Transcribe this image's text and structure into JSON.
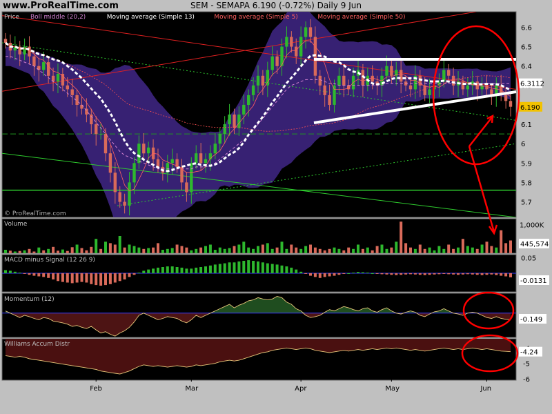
{
  "header": {
    "site": "www.ProRealTime.com",
    "title": "SEM - SEMAPA    6.190 (-0.72%)    Daily  9 Jun"
  },
  "watermark": "© ProRealTime.com",
  "colors": {
    "band": "#3d2580",
    "bull": "#2eb82e",
    "bear": "#d96a5a",
    "price_badge": "#f2c200",
    "bb_badge": "#ffffff",
    "volume_badge": "#ffffff",
    "annotation": "#ff0000"
  },
  "chart_data": [
    {
      "panel": "price",
      "type": "candlestick",
      "legend": [
        "Price",
        "Boll middle (20,2)",
        "Moving average (Simple 13)",
        "Moving average (Simple 5)",
        "Moving average (Simple 50)"
      ],
      "legend_colors": [
        "#c0c0c0",
        "#d080d0",
        "#ffffff",
        "#ff6060",
        "#ff6060"
      ],
      "months": [
        "Feb",
        "Mar",
        "Apr",
        "May",
        "Jun"
      ],
      "month_index": [
        19,
        39,
        62,
        81,
        101
      ],
      "ylim": [
        5.62,
        6.68
      ],
      "yticks": [
        "6.6",
        "6.5",
        "6.4",
        "6.3",
        "6.2",
        "6.1",
        "6",
        "5.9",
        "5.8",
        "5.7"
      ],
      "last_price": "6.190",
      "bb_value": "6.3112",
      "close": [
        6.52,
        6.48,
        6.5,
        6.46,
        6.5,
        6.45,
        6.4,
        6.38,
        6.42,
        6.35,
        6.32,
        6.36,
        6.3,
        6.28,
        6.25,
        6.2,
        6.18,
        6.15,
        6.1,
        6.05,
        6.05,
        5.95,
        5.85,
        5.75,
        5.7,
        5.68,
        5.8,
        5.9,
        6.0,
        5.95,
        5.98,
        5.92,
        5.88,
        5.85,
        5.9,
        5.92,
        5.88,
        5.8,
        5.75,
        5.9,
        5.95,
        5.9,
        5.92,
        5.95,
        6.0,
        6.05,
        6.1,
        6.15,
        6.08,
        6.15,
        6.2,
        6.25,
        6.3,
        6.35,
        6.3,
        6.38,
        6.45,
        6.4,
        6.5,
        6.55,
        6.5,
        6.45,
        6.55,
        6.6,
        6.55,
        6.35,
        6.3,
        6.25,
        6.2,
        6.3,
        6.35,
        6.3,
        6.28,
        6.35,
        6.38,
        6.3,
        6.35,
        6.32,
        6.3,
        6.35,
        6.4,
        6.35,
        6.38,
        6.32,
        6.3,
        6.28,
        6.35,
        6.3,
        6.25,
        6.28,
        6.3,
        6.32,
        6.38,
        6.35,
        6.3,
        6.32,
        6.28,
        6.3,
        6.32,
        6.28,
        6.3,
        6.28,
        6.25,
        6.3,
        6.25,
        6.22,
        6.19
      ],
      "bb_middle": [
        6.45,
        6.45,
        6.44,
        6.43,
        6.42,
        6.41,
        6.4,
        6.38,
        6.36,
        6.34,
        6.32,
        6.3,
        6.28,
        6.26,
        6.24,
        6.22,
        6.2,
        6.17,
        6.14,
        6.11,
        6.08,
        6.05,
        6.02,
        5.99,
        5.96,
        5.94,
        5.93,
        5.92,
        5.91,
        5.9,
        5.89,
        5.88,
        5.87,
        5.87,
        5.87,
        5.87,
        5.87,
        5.87,
        5.87,
        5.87,
        5.88,
        5.88,
        5.88,
        5.89,
        5.9,
        5.92,
        5.94,
        5.96,
        5.98,
        6.0,
        6.02,
        6.04,
        6.07,
        6.1,
        6.13,
        6.16,
        6.19,
        6.22,
        6.25,
        6.28,
        6.3,
        6.31,
        6.32,
        6.33,
        6.33,
        6.33,
        6.33,
        6.32,
        6.31,
        6.31,
        6.3,
        6.3,
        6.3,
        6.3,
        6.3,
        6.3,
        6.3,
        6.3,
        6.3,
        6.3,
        6.31,
        6.31,
        6.31,
        6.31,
        6.31,
        6.31,
        6.31,
        6.31,
        6.31,
        6.31,
        6.31,
        6.31,
        6.31,
        6.31,
        6.31,
        6.31,
        6.31,
        6.31,
        6.31,
        6.31,
        6.31,
        6.31,
        6.31,
        6.31,
        6.31,
        6.31,
        6.31
      ]
    },
    {
      "panel": "volume",
      "type": "bar",
      "legend": "Volume",
      "ytick": "1,000K",
      "last_value": "445,574",
      "ylim": [
        0,
        1200
      ],
      "values": [
        120,
        90,
        60,
        80,
        100,
        150,
        60,
        200,
        100,
        150,
        220,
        90,
        130,
        80,
        210,
        300,
        180,
        100,
        220,
        500,
        150,
        400,
        350,
        300,
        600,
        200,
        300,
        250,
        200,
        150,
        180,
        200,
        350,
        120,
        150,
        180,
        300,
        250,
        200,
        100,
        150,
        200,
        250,
        300,
        120,
        200,
        150,
        180,
        250,
        300,
        400,
        200,
        150,
        250,
        300,
        350,
        150,
        200,
        400,
        150,
        300,
        200,
        150,
        250,
        300,
        200,
        150,
        100,
        150,
        200,
        150,
        100,
        200,
        150,
        300,
        150,
        200,
        100,
        250,
        300,
        150,
        200,
        400,
        1100,
        350,
        200,
        150,
        300,
        150,
        200,
        100,
        250,
        150,
        300,
        150,
        200,
        500,
        250,
        200,
        150,
        300,
        400,
        250,
        200,
        800,
        350,
        445
      ],
      "up": [
        1,
        0,
        1,
        0,
        1,
        0,
        0,
        1,
        0,
        1,
        0,
        0,
        1,
        0,
        0,
        1,
        0,
        0,
        0,
        1,
        0,
        1,
        0,
        0,
        1,
        0,
        1,
        1,
        1,
        0,
        1,
        0,
        0,
        1,
        1,
        1,
        0,
        0,
        0,
        1,
        1,
        0,
        1,
        1,
        1,
        1,
        1,
        1,
        0,
        1,
        1,
        1,
        1,
        1,
        0,
        1,
        1,
        0,
        1,
        1,
        0,
        0,
        1,
        1,
        0,
        0,
        0,
        0,
        0,
        1,
        1,
        0,
        0,
        1,
        1,
        0,
        1,
        0,
        0,
        1,
        1,
        0,
        1,
        0,
        0,
        0,
        1,
        0,
        0,
        1,
        1,
        1,
        1,
        0,
        0,
        1,
        0,
        1,
        1,
        0,
        1,
        0,
        0,
        1,
        0,
        0,
        0
      ]
    },
    {
      "panel": "macd",
      "type": "bar",
      "legend": "MACD minus Signal (12 26 9)",
      "ytick": "0.05",
      "last_value": "-0.0131",
      "ylim": [
        -0.06,
        0.06
      ],
      "values": [
        0.01,
        0.008,
        0.005,
        0.002,
        -0.002,
        -0.005,
        -0.008,
        -0.01,
        -0.012,
        -0.015,
        -0.02,
        -0.025,
        -0.028,
        -0.03,
        -0.032,
        -0.03,
        -0.028,
        -0.03,
        -0.035,
        -0.038,
        -0.04,
        -0.038,
        -0.035,
        -0.03,
        -0.025,
        -0.02,
        -0.012,
        -0.005,
        0.002,
        0.008,
        0.012,
        0.015,
        0.018,
        0.02,
        0.022,
        0.022,
        0.02,
        0.018,
        0.015,
        0.015,
        0.018,
        0.02,
        0.022,
        0.025,
        0.028,
        0.03,
        0.032,
        0.035,
        0.035,
        0.038,
        0.04,
        0.042,
        0.04,
        0.038,
        0.035,
        0.032,
        0.03,
        0.028,
        0.025,
        0.022,
        0.018,
        0.012,
        0.005,
        -0.002,
        -0.008,
        -0.012,
        -0.015,
        -0.012,
        -0.01,
        -0.008,
        -0.005,
        -0.002,
        0.0,
        0.002,
        0.004,
        0.003,
        0.002,
        0.0,
        -0.002,
        -0.003,
        -0.004,
        -0.005,
        -0.006,
        -0.005,
        -0.004,
        -0.003,
        -0.004,
        -0.005,
        -0.006,
        -0.005,
        -0.004,
        -0.003,
        -0.002,
        -0.003,
        -0.004,
        -0.005,
        -0.004,
        -0.003,
        -0.004,
        -0.005,
        -0.006,
        -0.005,
        -0.004,
        -0.006,
        -0.008,
        -0.01,
        -0.0131
      ]
    },
    {
      "panel": "momentum",
      "type": "line",
      "legend": "Momentum (12)",
      "last_value": "-0.149",
      "ylim": [
        -0.55,
        0.45
      ],
      "values": [
        0.05,
        0.0,
        -0.05,
        -0.1,
        -0.05,
        -0.08,
        -0.12,
        -0.15,
        -0.1,
        -0.12,
        -0.18,
        -0.2,
        -0.22,
        -0.25,
        -0.3,
        -0.28,
        -0.32,
        -0.35,
        -0.3,
        -0.38,
        -0.45,
        -0.42,
        -0.48,
        -0.52,
        -0.45,
        -0.4,
        -0.32,
        -0.2,
        -0.05,
        0.0,
        -0.05,
        -0.1,
        -0.15,
        -0.12,
        -0.08,
        -0.1,
        -0.12,
        -0.18,
        -0.22,
        -0.15,
        -0.05,
        -0.1,
        -0.05,
        0.0,
        0.05,
        0.1,
        0.15,
        0.2,
        0.12,
        0.18,
        0.22,
        0.28,
        0.3,
        0.35,
        0.32,
        0.3,
        0.32,
        0.38,
        0.35,
        0.25,
        0.2,
        0.1,
        0.05,
        -0.05,
        -0.1,
        -0.08,
        -0.05,
        0.02,
        0.08,
        0.05,
        0.1,
        0.15,
        0.12,
        0.08,
        0.05,
        0.1,
        0.12,
        0.05,
        0.02,
        0.08,
        0.12,
        0.05,
        0.0,
        -0.02,
        0.02,
        0.05,
        0.02,
        -0.05,
        -0.08,
        -0.02,
        0.03,
        0.05,
        0.1,
        0.05,
        0.0,
        -0.02,
        -0.05,
        0.0,
        0.02,
        0.0,
        -0.05,
        -0.1,
        -0.12,
        -0.08,
        -0.12,
        -0.14,
        -0.149
      ]
    },
    {
      "panel": "williams",
      "type": "line",
      "legend": "Williams Accum Distr",
      "yticks": [
        "-4",
        "-5",
        "-6"
      ],
      "last_value": "-4.24",
      "ylim": [
        -6.1,
        -3.4
      ],
      "values": [
        -4.5,
        -4.55,
        -4.6,
        -4.55,
        -4.6,
        -4.7,
        -4.75,
        -4.8,
        -4.85,
        -4.9,
        -4.95,
        -5.0,
        -5.05,
        -5.1,
        -5.15,
        -5.2,
        -5.25,
        -5.3,
        -5.35,
        -5.4,
        -5.5,
        -5.55,
        -5.6,
        -5.65,
        -5.7,
        -5.6,
        -5.5,
        -5.35,
        -5.2,
        -5.1,
        -5.15,
        -5.2,
        -5.15,
        -5.2,
        -5.25,
        -5.2,
        -5.15,
        -5.2,
        -5.25,
        -5.2,
        -5.1,
        -5.15,
        -5.1,
        -5.05,
        -5.0,
        -4.9,
        -4.85,
        -4.8,
        -4.85,
        -4.8,
        -4.7,
        -4.6,
        -4.5,
        -4.4,
        -4.3,
        -4.25,
        -4.15,
        -4.1,
        -4.05,
        -4.0,
        -4.05,
        -4.1,
        -4.05,
        -4.0,
        -4.05,
        -4.15,
        -4.2,
        -4.25,
        -4.3,
        -4.25,
        -4.2,
        -4.15,
        -4.2,
        -4.15,
        -4.1,
        -4.15,
        -4.1,
        -4.05,
        -4.1,
        -4.05,
        -4.0,
        -4.05,
        -4.0,
        -4.05,
        -4.1,
        -4.15,
        -4.1,
        -4.15,
        -4.2,
        -4.15,
        -4.1,
        -4.05,
        -4.0,
        -4.05,
        -4.1,
        -4.05,
        -4.1,
        -4.05,
        -4.0,
        -4.05,
        -4.1,
        -4.05,
        -4.1,
        -4.15,
        -4.2,
        -4.22,
        -4.24
      ]
    }
  ]
}
